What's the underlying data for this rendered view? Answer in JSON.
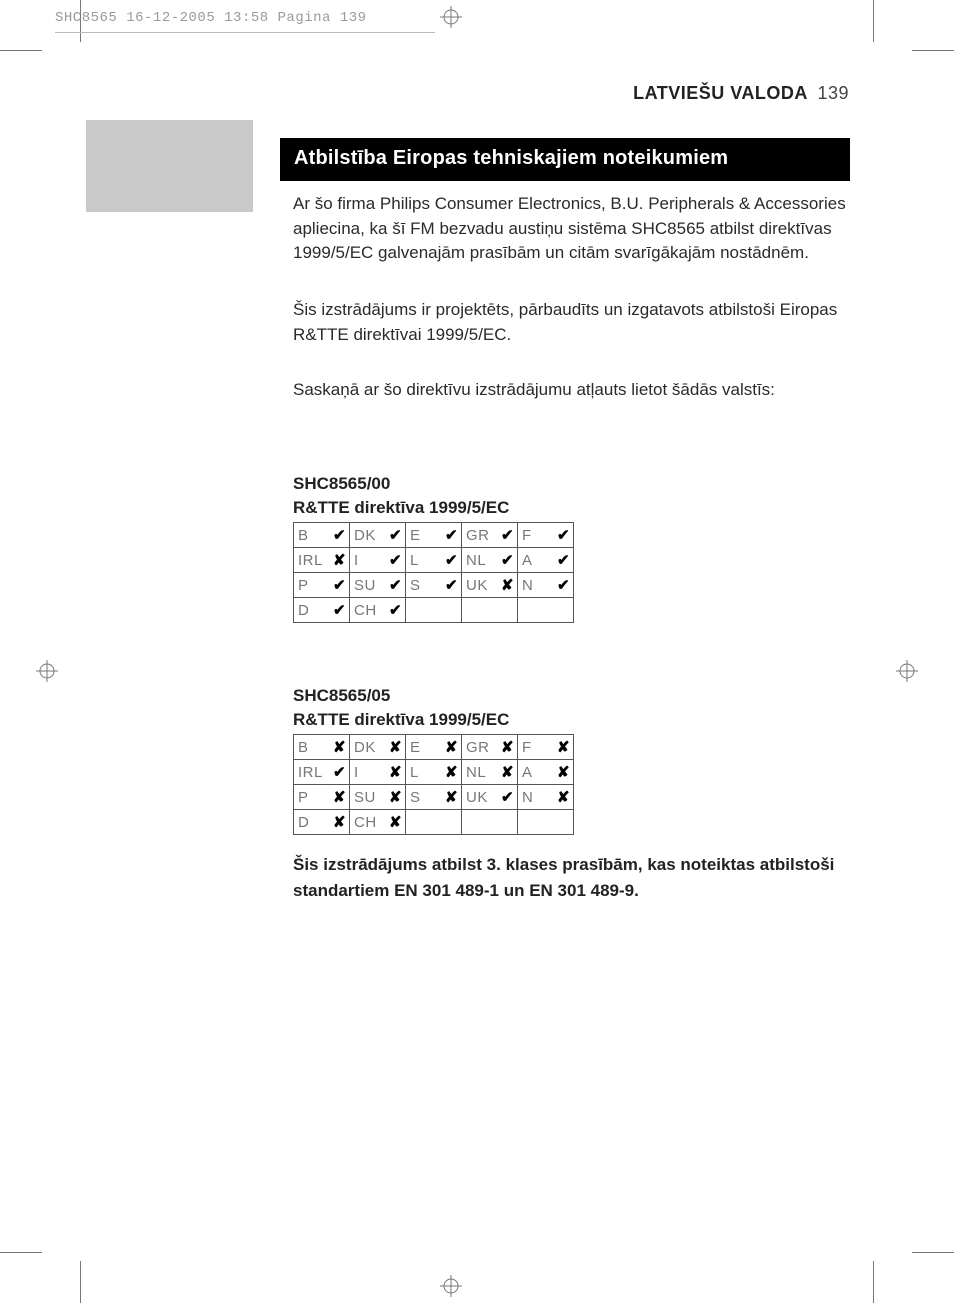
{
  "print_header": "SHC8565  16-12-2005  13:58  Pagina 139",
  "page_head": {
    "lang": "LATVIEŠU VALODA",
    "num": "139"
  },
  "title": "Atbilstība Eiropas tehniskajiem noteikumiem",
  "paragraphs": {
    "p1": "Ar šo firma Philips Consumer Electronics, B.U. Peripherals & Accessories apliecina, ka šī FM bezvadu austiņu sistēma SHC8565 atbilst direktīvas 1999/5/EC galvenajām prasībām un citām svarīgākajām nostādnēm.",
    "p2": "Šis izstrādājums ir projektēts, pārbaudīts un izgatavots atbilstoši Eiropas R&TTE direktīvai 1999/5/EC.",
    "p3": "Saskaņā ar šo direktīvu izstrādājumu atļauts lietot šādās valstīs:"
  },
  "table1": {
    "heading_line1": "SHC8565/00",
    "heading_line2": "R&TTE direktīva 1999/5/EC",
    "rows": [
      [
        {
          "c": "B",
          "m": "✔"
        },
        {
          "c": "DK",
          "m": "✔"
        },
        {
          "c": "E",
          "m": "✔"
        },
        {
          "c": "GR",
          "m": "✔"
        },
        {
          "c": "F",
          "m": "✔"
        }
      ],
      [
        {
          "c": "IRL",
          "m": "✘"
        },
        {
          "c": "I",
          "m": "✔"
        },
        {
          "c": "L",
          "m": "✔"
        },
        {
          "c": "NL",
          "m": "✔"
        },
        {
          "c": "A",
          "m": "✔"
        }
      ],
      [
        {
          "c": "P",
          "m": "✔"
        },
        {
          "c": "SU",
          "m": "✔"
        },
        {
          "c": "S",
          "m": "✔"
        },
        {
          "c": "UK",
          "m": "✘"
        },
        {
          "c": "N",
          "m": "✔"
        }
      ],
      [
        {
          "c": "D",
          "m": "✔"
        },
        {
          "c": "CH",
          "m": "✔"
        },
        {
          "c": "",
          "m": ""
        },
        {
          "c": "",
          "m": ""
        },
        {
          "c": "",
          "m": ""
        }
      ]
    ]
  },
  "table2": {
    "heading_line1": "SHC8565/05",
    "heading_line2": "R&TTE direktīva 1999/5/EC",
    "rows": [
      [
        {
          "c": "B",
          "m": "✘"
        },
        {
          "c": "DK",
          "m": "✘"
        },
        {
          "c": "E",
          "m": "✘"
        },
        {
          "c": "GR",
          "m": "✘"
        },
        {
          "c": "F",
          "m": "✘"
        }
      ],
      [
        {
          "c": "IRL",
          "m": "✔"
        },
        {
          "c": "I",
          "m": "✘"
        },
        {
          "c": "L",
          "m": "✘"
        },
        {
          "c": "NL",
          "m": "✘"
        },
        {
          "c": "A",
          "m": "✘"
        }
      ],
      [
        {
          "c": "P",
          "m": "✘"
        },
        {
          "c": "SU",
          "m": "✘"
        },
        {
          "c": "S",
          "m": "✘"
        },
        {
          "c": "UK",
          "m": "✔"
        },
        {
          "c": "N",
          "m": "✘"
        }
      ],
      [
        {
          "c": "D",
          "m": "✘"
        },
        {
          "c": "CH",
          "m": "✘"
        },
        {
          "c": "",
          "m": ""
        },
        {
          "c": "",
          "m": ""
        },
        {
          "c": "",
          "m": ""
        }
      ]
    ]
  },
  "footnote": "Šis izstrādājums atbilst 3. klases prasībām, kas noteiktas atbilstoši standartiem EN 301 489-1 un EN 301 489-9."
}
